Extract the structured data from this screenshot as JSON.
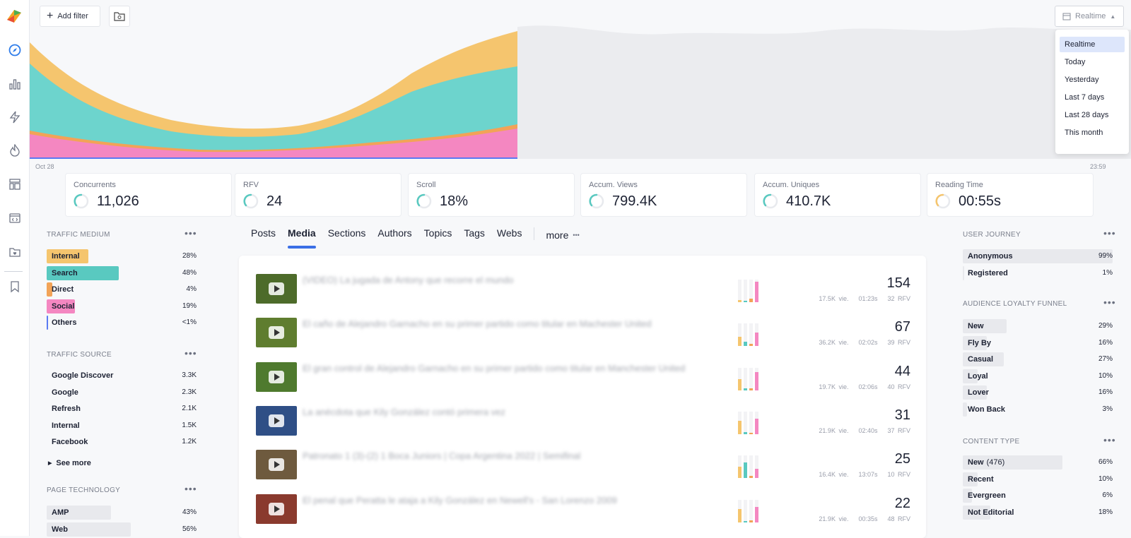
{
  "toolbar": {
    "add_filter": "Add filter"
  },
  "date_range": {
    "selected": "Realtime",
    "options": [
      "Realtime",
      "Today",
      "Yesterday",
      "Last 7 days",
      "Last 28 days",
      "This month"
    ]
  },
  "timeline": {
    "start_label": "Oct 28",
    "end_label": "23:59",
    "colors": {
      "internal": "#f5c56e",
      "search": "#6dd4cd",
      "direct": "#f2a357",
      "social": "#f487c1",
      "others": "#5a7af2"
    }
  },
  "kpis": [
    {
      "label": "Concurrents",
      "value": "11,026",
      "ring_color": "#59c9c0"
    },
    {
      "label": "RFV",
      "value": "24",
      "ring_color": "#59c9c0"
    },
    {
      "label": "Scroll",
      "value": "18%",
      "ring_color": "#59c9c0"
    },
    {
      "label": "Accum. Views",
      "value": "799.4K",
      "ring_color": "#59c9c0"
    },
    {
      "label": "Accum. Uniques",
      "value": "410.7K",
      "ring_color": "#59c9c0"
    },
    {
      "label": "Reading Time",
      "value": "00:55s",
      "ring_color": "#f5c56e"
    }
  ],
  "traffic_medium": {
    "title": "TRAFFIC MEDIUM",
    "items": [
      {
        "label": "Internal",
        "pct": "28%",
        "share": 0.28,
        "color": "#f5c56e"
      },
      {
        "label": "Search",
        "pct": "48%",
        "share": 0.48,
        "color": "#59c9c0"
      },
      {
        "label": "Direct",
        "pct": "4%",
        "share": 0.04,
        "color": "#f2a357"
      },
      {
        "label": "Social",
        "pct": "19%",
        "share": 0.19,
        "color": "#f487c1"
      },
      {
        "label": "Others",
        "pct": "<1%",
        "share": 0.005,
        "color": "#5a7af2"
      }
    ]
  },
  "traffic_source": {
    "title": "TRAFFIC SOURCE",
    "items": [
      {
        "label": "Google Discover",
        "value": "3.3K"
      },
      {
        "label": "Google",
        "value": "2.3K"
      },
      {
        "label": "Refresh",
        "value": "2.1K"
      },
      {
        "label": "Internal",
        "value": "1.5K"
      },
      {
        "label": "Facebook",
        "value": "1.2K"
      }
    ],
    "see_more": "See more"
  },
  "page_technology": {
    "title": "PAGE TECHNOLOGY",
    "items": [
      {
        "label": "AMP",
        "pct": "43%",
        "share": 0.43
      },
      {
        "label": "Web",
        "pct": "56%",
        "share": 0.56
      }
    ]
  },
  "tabs": [
    "Posts",
    "Media",
    "Sections",
    "Authors",
    "Topics",
    "Tags",
    "Webs"
  ],
  "active_tab": "Media",
  "more_label": "more",
  "media_list": [
    {
      "title": "(VIDEO) La jugada de Antony que recorre el mundo",
      "value": "154",
      "views": "17.5K vie.",
      "time": "01:23s",
      "rfv": "32 RFV",
      "thumb": "#4d6b2a"
    },
    {
      "title": "El caño de Alejandro Garnacho en su primer partido como titular en Machester United",
      "value": "67",
      "views": "36.2K vie.",
      "time": "02:02s",
      "rfv": "39 RFV",
      "thumb": "#5f7d2f"
    },
    {
      "title": "El gran control de Alejandro Garnacho en su primer partido como titular en Manchester United",
      "value": "44",
      "views": "19.7K vie.",
      "time": "02:06s",
      "rfv": "40 RFV",
      "thumb": "#4f7a2e"
    },
    {
      "title": "La anécdota que Kily González contó primera vez",
      "value": "31",
      "views": "21.9K vie.",
      "time": "02:40s",
      "rfv": "37 RFV",
      "thumb": "#2f4f86"
    },
    {
      "title": "Patronato 1 (3)-(2) 1 Boca Juniors | Copa Argentina 2022 | Semifinal",
      "value": "25",
      "views": "16.4K vie.",
      "time": "13:07s",
      "rfv": "10 RFV",
      "thumb": "#6e5a3e"
    },
    {
      "title": "El penal que Peratta le ataja a Kily González en Newell's - San Lorenzo 2009",
      "value": "22",
      "views": "21.9K vie.",
      "time": "00:35s",
      "rfv": "48 RFV",
      "thumb": "#8a3a2e"
    }
  ],
  "user_journey": {
    "title": "USER JOURNEY",
    "items": [
      {
        "label": "Anonymous",
        "pct": "99%",
        "share": 0.99
      },
      {
        "label": "Registered",
        "pct": "1%",
        "share": 0.01
      }
    ]
  },
  "loyalty_funnel": {
    "title": "AUDIENCE LOYALTY FUNNEL",
    "items": [
      {
        "label": "New",
        "pct": "29%",
        "share": 0.29
      },
      {
        "label": "Fly By",
        "pct": "16%",
        "share": 0.16
      },
      {
        "label": "Casual",
        "pct": "27%",
        "share": 0.27
      },
      {
        "label": "Loyal",
        "pct": "10%",
        "share": 0.1
      },
      {
        "label": "Lover",
        "pct": "16%",
        "share": 0.16
      },
      {
        "label": "Won Back",
        "pct": "3%",
        "share": 0.03
      }
    ]
  },
  "content_type": {
    "title": "CONTENT TYPE",
    "items": [
      {
        "label": "New",
        "count": "(476)",
        "pct": "66%",
        "share": 0.66
      },
      {
        "label": "Recent",
        "count": "",
        "pct": "10%",
        "share": 0.1
      },
      {
        "label": "Evergreen",
        "count": "",
        "pct": "6%",
        "share": 0.06
      },
      {
        "label": "Not Editorial",
        "count": "",
        "pct": "18%",
        "share": 0.18
      }
    ]
  }
}
